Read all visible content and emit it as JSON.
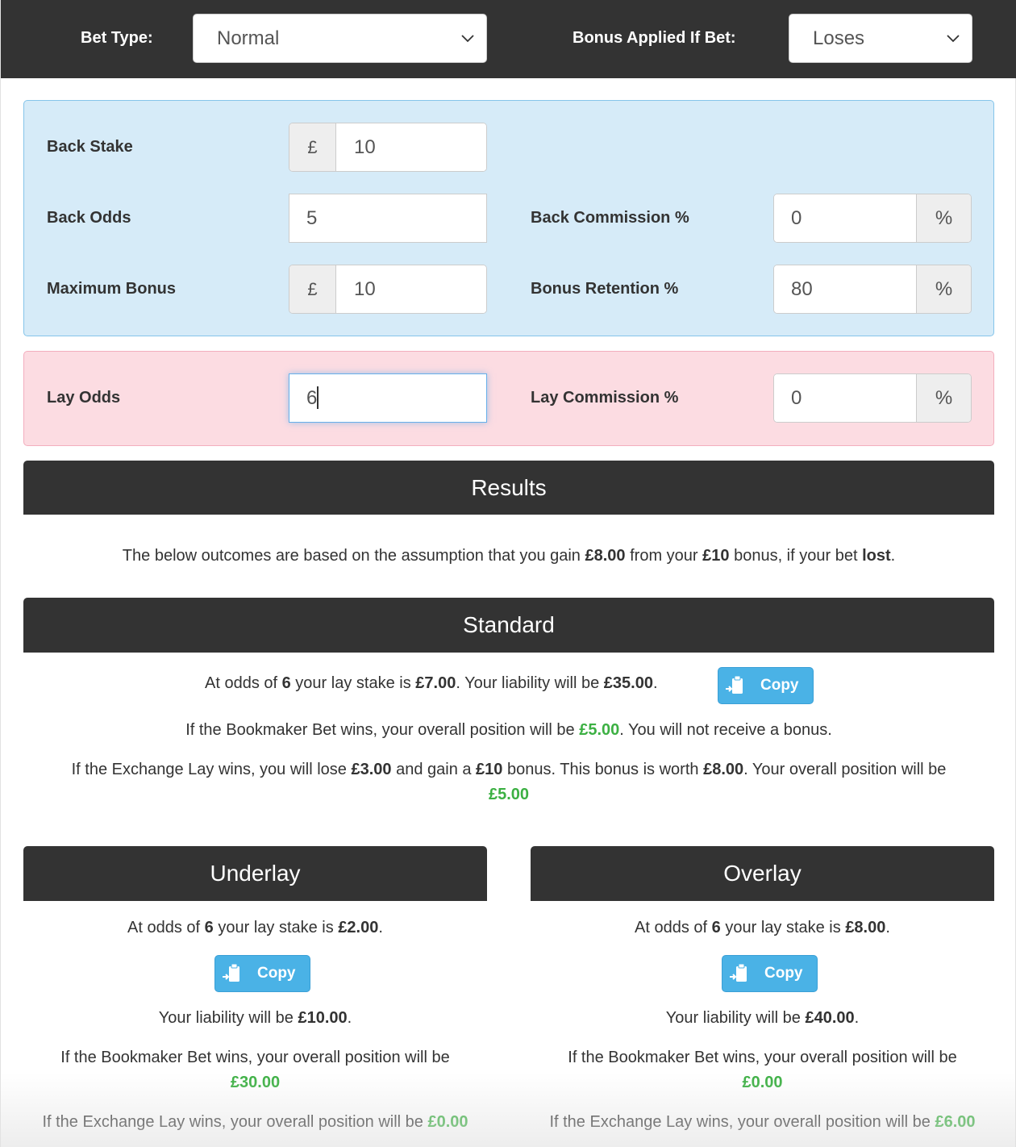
{
  "topbar": {
    "bet_type_label": "Bet Type:",
    "bet_type_value": "Normal",
    "bonus_applied_label": "Bonus Applied If Bet:",
    "bonus_applied_value": "Loses"
  },
  "back_panel": {
    "back_stake": {
      "label": "Back Stake",
      "prefix": "£",
      "value": "10"
    },
    "back_odds": {
      "label": "Back Odds",
      "value": "5"
    },
    "maximum_bonus": {
      "label": "Maximum Bonus",
      "prefix": "£",
      "value": "10"
    },
    "back_commission": {
      "label": "Back Commission %",
      "value": "0",
      "suffix": "%"
    },
    "bonus_retention": {
      "label": "Bonus Retention %",
      "value": "80",
      "suffix": "%"
    }
  },
  "lay_panel": {
    "lay_odds": {
      "label": "Lay Odds",
      "value": "6"
    },
    "lay_commission": {
      "label": "Lay Commission %",
      "value": "0",
      "suffix": "%"
    }
  },
  "results": {
    "title": "Results",
    "assumption": {
      "t1": "The below outcomes are based on the assumption that you gain ",
      "gain": "£8.00",
      "t2": " from your ",
      "bonus": "£10",
      "t3": " bonus, if your bet ",
      "outcome": "lost",
      "t4": "."
    }
  },
  "standard": {
    "title": "Standard",
    "stake_line": {
      "t1": "At odds of ",
      "odds": "6",
      "t2": " your lay stake is ",
      "stake": "£7.00",
      "t3": ". Your liability will be ",
      "liability": "£35.00",
      "t4": "."
    },
    "copy_label": "Copy",
    "bookmaker_line": {
      "t1": "If the Bookmaker Bet wins, your overall position will be ",
      "position": "£5.00",
      "t2": ". You will not receive a bonus."
    },
    "exchange_line": {
      "t1": "If the Exchange Lay wins, you will lose ",
      "lose": "£3.00",
      "t2": " and gain a ",
      "bonus": "£10",
      "t3": " bonus. This bonus is worth ",
      "worth": "£8.00",
      "t4": ". Your overall position will be",
      "position": "£5.00"
    }
  },
  "underlay": {
    "title": "Underlay",
    "stake_line": {
      "t1": "At odds of ",
      "odds": "6",
      "t2": " your lay stake is ",
      "stake": "£2.00",
      "t3": "."
    },
    "copy_label": "Copy",
    "liability_line": {
      "t1": "Your liability will be ",
      "liability": "£10.00",
      "t2": "."
    },
    "bookmaker_line": {
      "t1": "If the Bookmaker Bet wins, your overall position will be",
      "position": "£30.00"
    },
    "exchange_line": {
      "t1": "If the Exchange Lay wins, your overall position will be ",
      "position": "£0.00"
    }
  },
  "overlay": {
    "title": "Overlay",
    "stake_line": {
      "t1": "At odds of ",
      "odds": "6",
      "t2": " your lay stake is ",
      "stake": "£8.00",
      "t3": "."
    },
    "copy_label": "Copy",
    "liability_line": {
      "t1": "Your liability will be ",
      "liability": "£40.00",
      "t2": "."
    },
    "bookmaker_line": {
      "t1": "If the Bookmaker Bet wins, your overall position will be",
      "position": "£0.00"
    },
    "exchange_line": {
      "t1": "If the Exchange Lay wins, your overall position will be ",
      "position": "£6.00"
    }
  },
  "colors": {
    "header_bg": "#333333",
    "back_panel_bg": "#d6ebf8",
    "lay_panel_bg": "#fcdce2",
    "copy_button": "#4ab2e6",
    "positive_value": "#3cb043"
  }
}
